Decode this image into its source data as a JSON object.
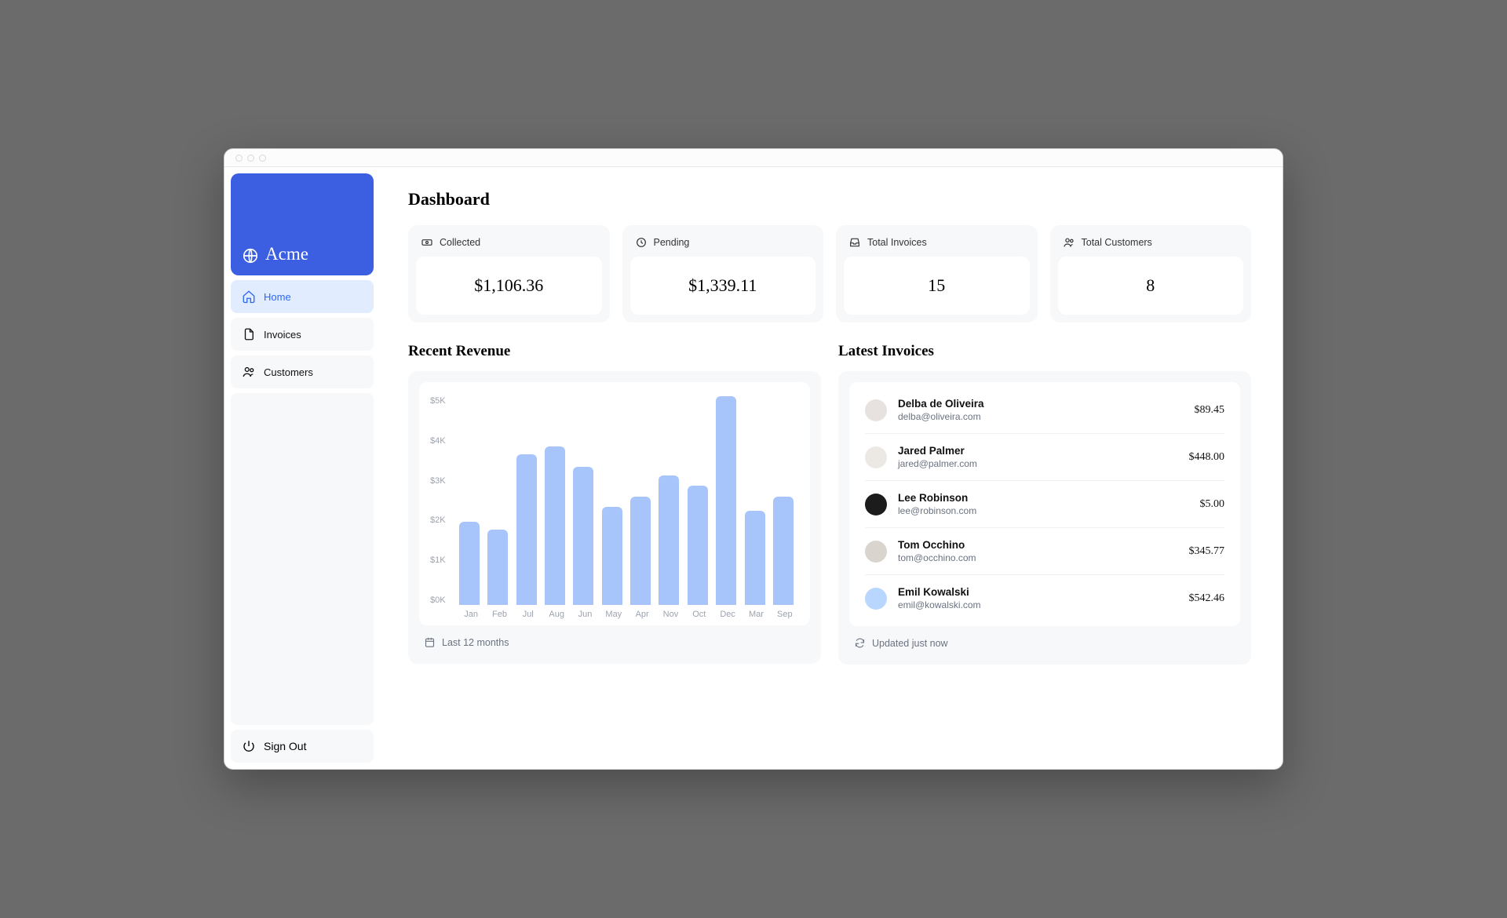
{
  "brand": {
    "name": "Acme"
  },
  "sidebar": {
    "items": [
      {
        "label": "Home",
        "icon": "home"
      },
      {
        "label": "Invoices",
        "icon": "document"
      },
      {
        "label": "Customers",
        "icon": "users"
      }
    ],
    "signout_label": "Sign Out"
  },
  "page_title": "Dashboard",
  "stats": [
    {
      "label": "Collected",
      "value": "$1,106.36",
      "icon": "banknote"
    },
    {
      "label": "Pending",
      "value": "$1,339.11",
      "icon": "clock"
    },
    {
      "label": "Total Invoices",
      "value": "15",
      "icon": "inbox"
    },
    {
      "label": "Total Customers",
      "value": "8",
      "icon": "users"
    }
  ],
  "revenue": {
    "title": "Recent Revenue",
    "footnote": "Last 12 months"
  },
  "invoices": {
    "title": "Latest Invoices",
    "footnote": "Updated just now",
    "rows": [
      {
        "name": "Delba de Oliveira",
        "email": "delba@oliveira.com",
        "amount": "$89.45"
      },
      {
        "name": "Jared Palmer",
        "email": "jared@palmer.com",
        "amount": "$448.00"
      },
      {
        "name": "Lee Robinson",
        "email": "lee@robinson.com",
        "amount": "$5.00"
      },
      {
        "name": "Tom Occhino",
        "email": "tom@occhino.com",
        "amount": "$345.77"
      },
      {
        "name": "Emil Kowalski",
        "email": "emil@kowalski.com",
        "amount": "$542.46"
      }
    ]
  },
  "chart_data": {
    "type": "bar",
    "title": "Recent Revenue",
    "xlabel": "",
    "ylabel": "",
    "ylim": [
      0,
      5000
    ],
    "y_ticks": [
      "$0K",
      "$1K",
      "$2K",
      "$3K",
      "$4K",
      "$5K"
    ],
    "categories": [
      "Jan",
      "Feb",
      "Jul",
      "Aug",
      "Jun",
      "May",
      "Apr",
      "Nov",
      "Oct",
      "Dec",
      "Mar",
      "Sep"
    ],
    "values": [
      2000,
      1800,
      3600,
      3800,
      3300,
      2350,
      2600,
      3100,
      2850,
      5000,
      2250,
      2600
    ]
  }
}
